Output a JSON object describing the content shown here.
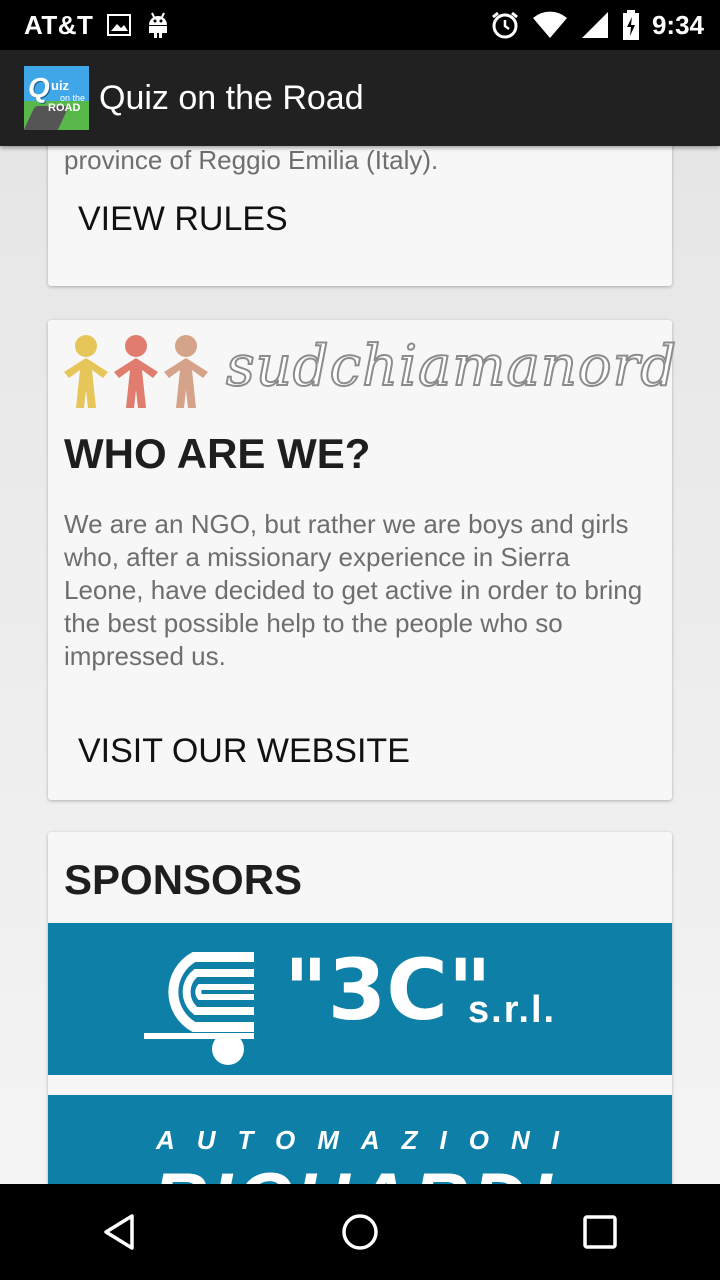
{
  "status_bar": {
    "carrier": "AT&T",
    "time": "9:34",
    "icons": [
      "image-icon",
      "android-icon",
      "alarm-icon",
      "wifi-icon",
      "signal-icon",
      "battery-charging-icon"
    ]
  },
  "app_bar": {
    "logo_text_q": "Q",
    "logo_text_uiz": "uiz",
    "logo_text_onthe": "on the",
    "logo_text_road": "ROAD",
    "title": "Quiz on the Road"
  },
  "rules_card": {
    "text_tail": "province of Reggio Emilia (Italy).",
    "action": "VIEW RULES"
  },
  "about_card": {
    "brand": "sudchiamanord",
    "heading": "WHO ARE WE?",
    "body": "We are an NGO, but rather we are boys and girls who, after a missionary experience in Sierra Leone, have decided to get active in order to bring the best possible help to the people who so impressed us.",
    "action": "VISIT OUR WEBSITE"
  },
  "sponsors_card": {
    "heading": "SPONSORS",
    "sponsor1_name": "\"3C\"",
    "sponsor1_suffix": "s.r.l.",
    "sponsor2_tagline": "AUTOMAZIONI",
    "sponsor2_name": "RICHARDI",
    "banner_color": "#0e7fa6"
  },
  "nav_bar": {
    "icons": [
      "back-icon",
      "home-icon",
      "recents-icon"
    ]
  }
}
